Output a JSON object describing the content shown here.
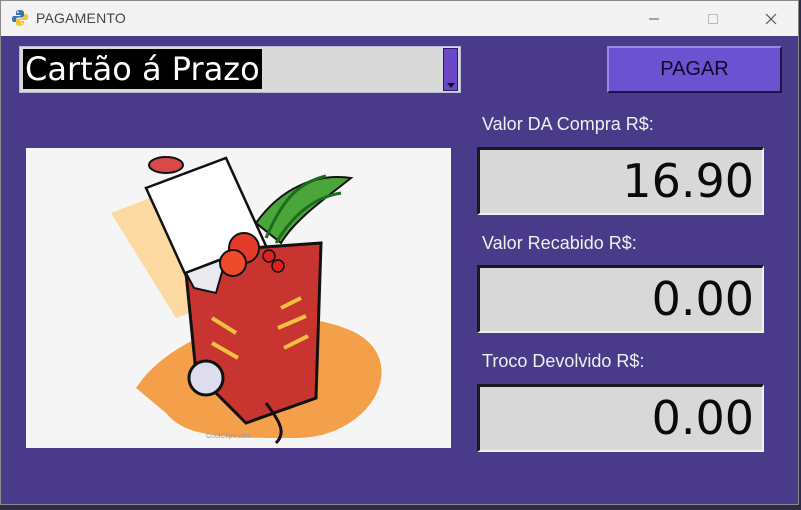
{
  "window": {
    "title": "PAGAMENTO",
    "app_icon": "python-icon",
    "controls": [
      "minimize-icon",
      "maximize-icon",
      "close-icon"
    ]
  },
  "payment_method": {
    "selected": "Cartão á Prazo",
    "icon": "dropdown-arrow-icon"
  },
  "pay_button": {
    "label": "PAGAR"
  },
  "image": {
    "watermark": "CoolClips.com"
  },
  "fields": {
    "purchase_label": "Valor DA Compra R$:",
    "purchase_value": "16.90",
    "received_label": "Valor Recabido R$:",
    "received_value": "0.00",
    "change_label": "Troco Devolvido R$:",
    "change_value": "0.00"
  },
  "colors": {
    "background": "#4a3a8a",
    "button": "#6a52d0",
    "field": "#d8d8d8"
  }
}
